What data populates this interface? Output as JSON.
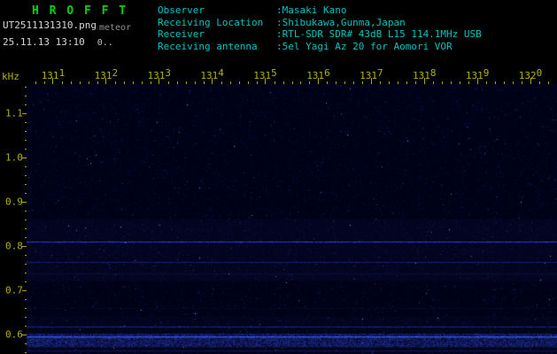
{
  "header": {
    "title": "H R O F F T",
    "filename": "UT2511131310.png",
    "mode": "meteor",
    "timestamp": "25.11.13 13:10",
    "counter": "0.."
  },
  "info": {
    "rows": [
      {
        "label": "Observer",
        "value": ":Masaki Kano"
      },
      {
        "label": "Receiving Location",
        "value": ":Shibukawa,Gunma,Japan"
      },
      {
        "label": "Receiver",
        "value": ":RTL-SDR SDR# 43dB L15 114.1MHz USB"
      },
      {
        "label": "Receiving antenna",
        "value": ":5el Yagi Az 20 for Aomori VOR"
      }
    ]
  },
  "plot": {
    "y_unit": "kHz"
  },
  "chart_data": {
    "type": "heatmap",
    "title": "HROFFT 10-minute meteor echo spectrogram",
    "x_ticks": [
      "1311",
      "1312",
      "1313",
      "1314",
      "1315",
      "1316",
      "1317",
      "1318",
      "1319",
      "1320"
    ],
    "x_span": "13:10-13:20 UT",
    "y_unit": "kHz",
    "y_ticks": [
      1.1,
      1.0,
      0.9,
      0.8,
      0.7,
      0.6
    ],
    "y_range": [
      0.555,
      1.165
    ],
    "grid": false,
    "noise_floor_color": "#000016",
    "signal_lines": [
      {
        "khz": 0.81,
        "color": "#3354e6",
        "base_alpha": 0.45,
        "var_alpha": 0.55,
        "bleed": 0.3
      },
      {
        "khz": 0.763,
        "color": "#2239b4",
        "base_alpha": 0.3,
        "var_alpha": 0.4,
        "bleed": 0.18
      },
      {
        "khz": 0.738,
        "color": "#17256f",
        "base_alpha": 0.15,
        "var_alpha": 0.3,
        "bleed": 0.1
      },
      {
        "khz": 0.66,
        "color": "#131f5e",
        "base_alpha": 0.1,
        "var_alpha": 0.22,
        "bleed": 0.06
      },
      {
        "khz": 0.617,
        "color": "#2742c4",
        "base_alpha": 0.3,
        "var_alpha": 0.45,
        "bleed": 0.2
      },
      {
        "khz": 0.563,
        "color": "#1c2f9a",
        "base_alpha": 0.22,
        "var_alpha": 0.35,
        "bleed": 0.12
      }
    ],
    "bottom_band": {
      "khz_top": 0.601,
      "khz_bottom": 0.574,
      "color": "#2d49dd",
      "line_khz": 0.5955,
      "line_color": "#3a5cff"
    },
    "baseline_line": {
      "khz": 0.5715,
      "color": "#5a1626",
      "alpha": 0.45
    },
    "noise": {
      "speckles": 14000,
      "bright_dots": 500,
      "stars": 60,
      "seed": 1234567
    }
  },
  "colors": {
    "title_green": "#00d400",
    "text_white": "#d8d8d8",
    "text_gray": "#8f8f8f",
    "info_cyan": "#00c3c3",
    "axis_yellow": "#b2b200"
  }
}
